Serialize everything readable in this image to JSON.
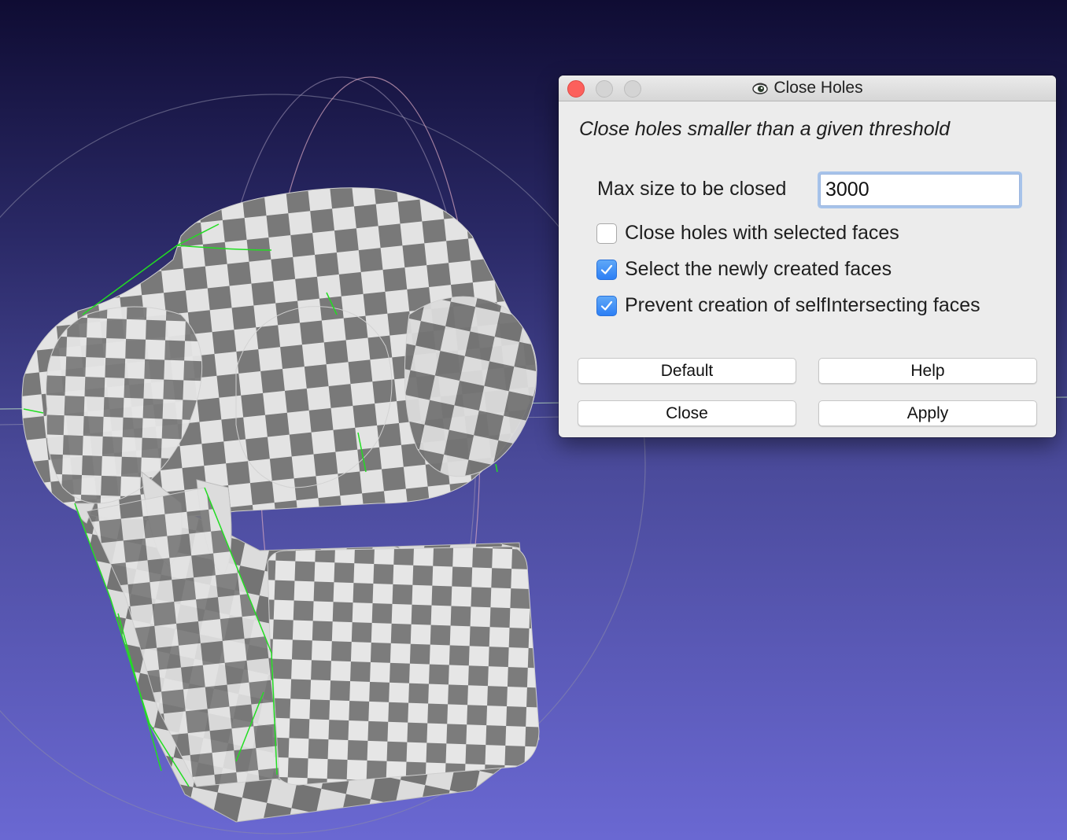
{
  "dialog": {
    "title": "Close Holes",
    "subtitle": "Close holes smaller than a given threshold",
    "max_size_label": "Max size to be closed",
    "max_size_value": "3000",
    "options": [
      {
        "label": "Close holes with selected faces",
        "checked": false
      },
      {
        "label": "Select the newly created faces",
        "checked": true
      },
      {
        "label": "Prevent creation of selfIntersecting faces",
        "checked": true
      }
    ],
    "buttons": {
      "default": "Default",
      "help": "Help",
      "close": "Close",
      "apply": "Apply"
    }
  },
  "colors": {
    "background_top": "#0f0c33",
    "background_bottom": "#6a68d2",
    "mesh_light": "#e4e4e4",
    "mesh_dark": "#7a7a7a",
    "boundary_edges": "#22dd22",
    "checkbox_accent": "#2d7ff5",
    "window_close": "#fc605c"
  }
}
